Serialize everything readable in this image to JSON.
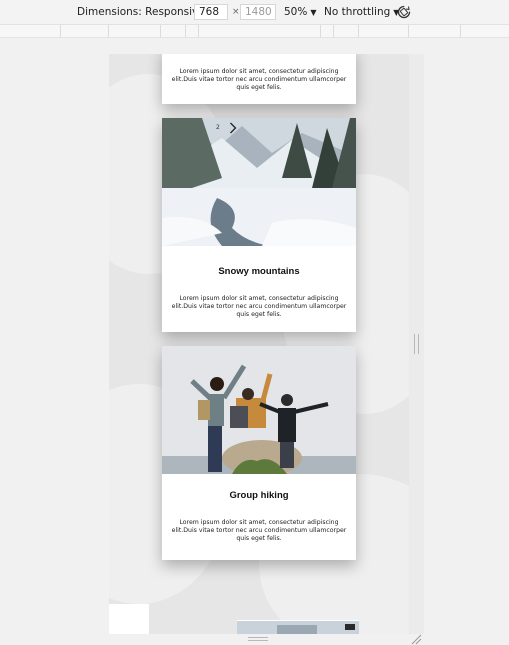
{
  "toolbar": {
    "dimensions_label": "Dimensions: Responsive",
    "width_value": "768",
    "times": "×",
    "height_value": "1480",
    "zoom": "50%",
    "throttling": "No throttling",
    "rotate_icon": "rotate-icon"
  },
  "cards": [
    {
      "text": "Lorem ipsum dolor sit amet, consectetur adipiscing elit.Duis vitae tortor nec arcu condimentum ullamcorper quis eget felis."
    },
    {
      "slide_number": "2",
      "next_icon": "chevron-right-icon",
      "title": "Snowy mountains",
      "text": "Lorem ipsum dolor sit amet, consectetur adipiscing elit.Duis vitae tortor nec arcu condimentum ullamcorper quis eget felis."
    },
    {
      "title": "Group hiking",
      "text": "Lorem ipsum dolor sit amet, consectetur adipiscing elit.Duis vitae tortor nec arcu condimentum ullamcorper quis eget felis."
    }
  ]
}
